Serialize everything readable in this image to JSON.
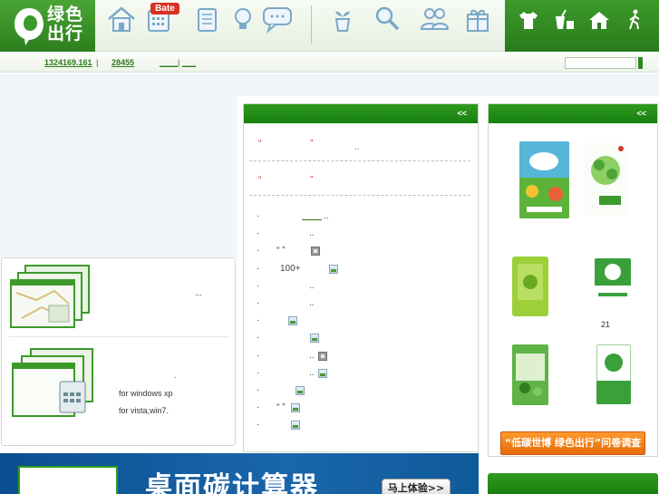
{
  "brand": {
    "logo_text": "绿色出行",
    "accent": "#2c8a1c",
    "header_bg": "#e9f1e4",
    "badge_color": "#d83022"
  },
  "nav": {
    "icons": [
      "home-icon",
      "calendar-icon",
      "notebook-icon",
      "lightbulb-icon",
      "chat-icon",
      "plant-pot-icon",
      "magnifier-icon",
      "users-icon",
      "gift-icon"
    ],
    "badge": "Bate"
  },
  "tools": {
    "icons": [
      "tshirt-icon",
      "drink-icon",
      "house-icon",
      "walker-icon"
    ]
  },
  "infobar": {
    "count_a": "1324169.161",
    "sep_a": "|",
    "count_b": "28455",
    "link_a": "____",
    "sep_b": "|",
    "link_b": "___"
  },
  "middle": {
    "more": "<<",
    "quote_1": "“",
    "quote_1_close": "”",
    "quote_1_tail": "..",
    "quote_2": "“",
    "quote_2_close": "”",
    "bullet": "·",
    "items": [
      {
        "text": "..",
        "has_link": true,
        "icon": ""
      },
      {
        "text": "..",
        "has_link": false,
        "icon": ""
      },
      {
        "text": "“          ”",
        "has_link": false,
        "icon": "video"
      },
      {
        "text": "100+",
        "has_link": false,
        "icon": "picture"
      },
      {
        "text": "..",
        "has_link": false,
        "icon": ""
      },
      {
        "text": "..",
        "has_link": false,
        "icon": ""
      },
      {
        "text": "",
        "has_link": false,
        "icon": "picture"
      },
      {
        "text": "",
        "has_link": false,
        "icon": "picture"
      },
      {
        "text": "..",
        "has_link": false,
        "icon": "video"
      },
      {
        "text": "..",
        "has_link": false,
        "icon": "picture"
      },
      {
        "text": "",
        "has_link": false,
        "icon": "picture"
      },
      {
        "text": "“   ”",
        "has_link": false,
        "icon": "picture"
      },
      {
        "text": "",
        "has_link": false,
        "icon": "picture"
      }
    ]
  },
  "downloads": {
    "ellipsis": "...",
    "dot": ".",
    "xp_label": "for windows xp",
    "vista_label": "for vista,win7."
  },
  "right": {
    "more": "<<",
    "caption": "21",
    "survey_label": "“低碳世博 绿色出行”问卷调查"
  },
  "banner": {
    "title": "桌面碳计算器",
    "button_label": "马上体验>>"
  }
}
